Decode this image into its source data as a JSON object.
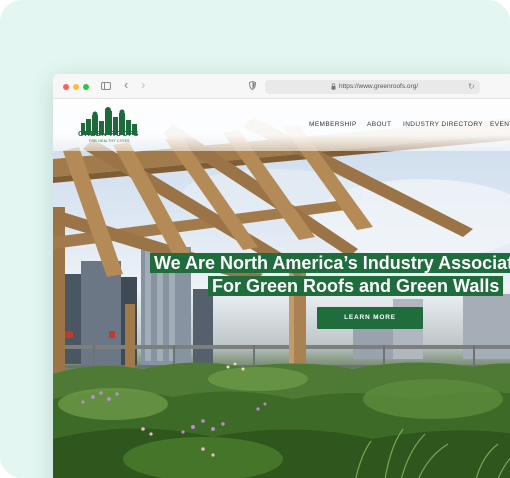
{
  "browser": {
    "url": "https://www.greenroofs.org/"
  },
  "site": {
    "logo_name": "GREEN ROOFS",
    "logo_tagline": "FOR HEALTHY CITIES",
    "nav": [
      "MEMBERSHIP",
      "ABOUT",
      "INDUSTRY DIRECTORY",
      "EVENTS"
    ]
  },
  "hero": {
    "headline_line1": "We Are North  America’s Industry Association",
    "headline_line2": "For Green Roofs and Green Walls",
    "cta_label": "LEARN MORE"
  },
  "colors": {
    "brand_green": "#1f6d3c",
    "backdrop_mint": "#e3f6f1"
  }
}
